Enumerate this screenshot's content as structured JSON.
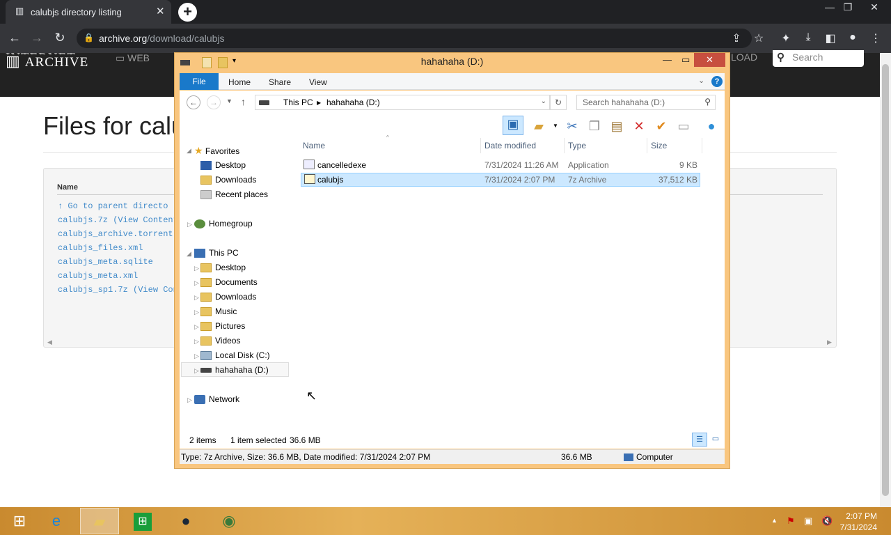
{
  "browser": {
    "tab_title": "calubjs directory listing",
    "tab_close": "✕",
    "new_tab": "+",
    "url_host": "archive.org",
    "url_path": "/download/calubjs",
    "min": "—",
    "restore": "❐",
    "close": "✕"
  },
  "ia": {
    "logo_line1": "INTERNET",
    "logo_line2": "ARCHIVE",
    "web": "WEB",
    "upload": "LOAD",
    "search_placeholder": "Search",
    "page_title": "Files for calu",
    "col_name": "Name",
    "files": [
      "↑ Go to parent directo",
      "calubjs.7z (View Content",
      "calubjs_archive.torrent",
      "calubjs_files.xml",
      "calubjs_meta.sqlite",
      "calubjs_meta.xml",
      "calubjs_sp1.7z (View Con"
    ]
  },
  "explorer": {
    "title": "hahahaha (D:)",
    "tabs": {
      "file": "File",
      "home": "Home",
      "share": "Share",
      "view": "View"
    },
    "help": "?",
    "breadcrumb": [
      "This PC",
      "hahahaha (D:)"
    ],
    "search_placeholder": "Search hahahaha (D:)",
    "nav": {
      "favorites": "Favorites",
      "fav_items": [
        "Desktop",
        "Downloads",
        "Recent places"
      ],
      "homegroup": "Homegroup",
      "thispc": "This PC",
      "pc_items": [
        "Desktop",
        "Documents",
        "Downloads",
        "Music",
        "Pictures",
        "Videos",
        "Local Disk (C:)",
        "hahahaha (D:)"
      ],
      "network": "Network"
    },
    "columns": {
      "name": "Name",
      "date": "Date modified",
      "type": "Type",
      "size": "Size"
    },
    "files": [
      {
        "name": "cancelledexe",
        "date": "7/31/2024 11:26 AM",
        "type": "Application",
        "size": "9 KB"
      },
      {
        "name": "calubjs",
        "date": "7/31/2024 2:07 PM",
        "type": "7z Archive",
        "size": "37,512 KB"
      }
    ],
    "status": {
      "items": "2 items",
      "selected": "1 item selected",
      "sel_size": "36.6 MB"
    },
    "info": {
      "details": "Type: 7z Archive, Size: 36.6 MB, Date modified: 7/31/2024 2:07 PM",
      "size": "36.6 MB",
      "location": "Computer"
    }
  },
  "taskbar": {
    "time": "2:07 PM",
    "date": "7/31/2024"
  }
}
